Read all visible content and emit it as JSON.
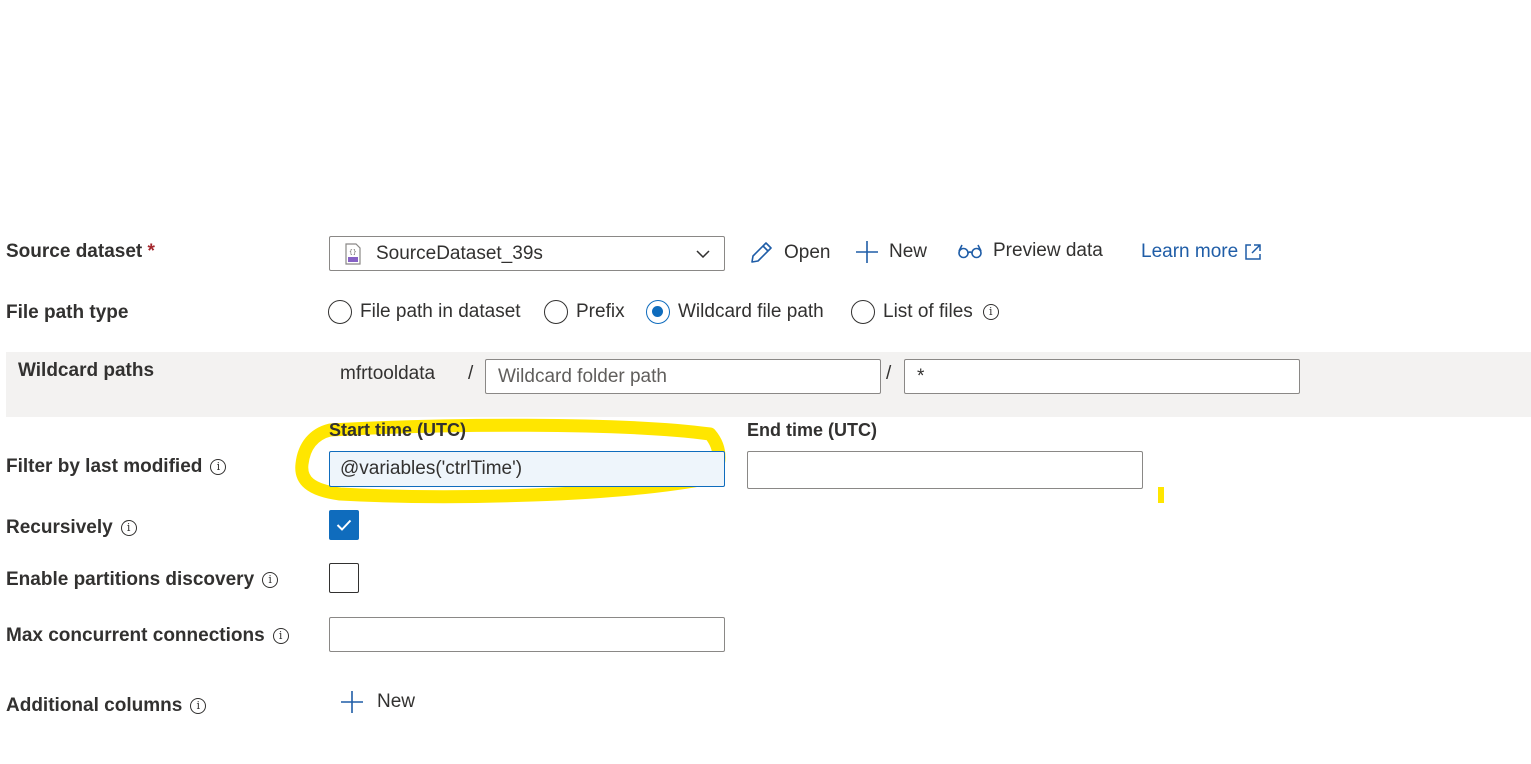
{
  "source_dataset": {
    "label": "Source dataset",
    "required_mark": "*",
    "selected": "SourceDataset_39s",
    "open_label": "Open",
    "new_label": "New",
    "preview_label": "Preview data",
    "learn_more_label": "Learn more"
  },
  "file_path_type": {
    "label": "File path type",
    "options": [
      {
        "label": "File path in dataset",
        "checked": false
      },
      {
        "label": "Prefix",
        "checked": false
      },
      {
        "label": "Wildcard file path",
        "checked": true
      },
      {
        "label": "List of files",
        "checked": false
      }
    ]
  },
  "wildcard_paths": {
    "label": "Wildcard paths",
    "container": "mfrtooldata",
    "separator": "/",
    "folder_placeholder": "Wildcard folder path",
    "file_value": "*"
  },
  "filter_last_modified": {
    "label": "Filter by last modified",
    "start_label": "Start time (UTC)",
    "start_value": "@variables('ctrlTime')",
    "end_label": "End time (UTC)",
    "end_value": ""
  },
  "recursively": {
    "label": "Recursively",
    "checked": true
  },
  "partitions": {
    "label": "Enable partitions discovery",
    "checked": false
  },
  "max_connections": {
    "label": "Max concurrent connections",
    "value": ""
  },
  "additional_columns": {
    "label": "Additional columns",
    "new_label": "New"
  },
  "colors": {
    "accent": "#0f6cbd",
    "highlight": "#ffe600",
    "row_bg": "#f3f2f1"
  }
}
